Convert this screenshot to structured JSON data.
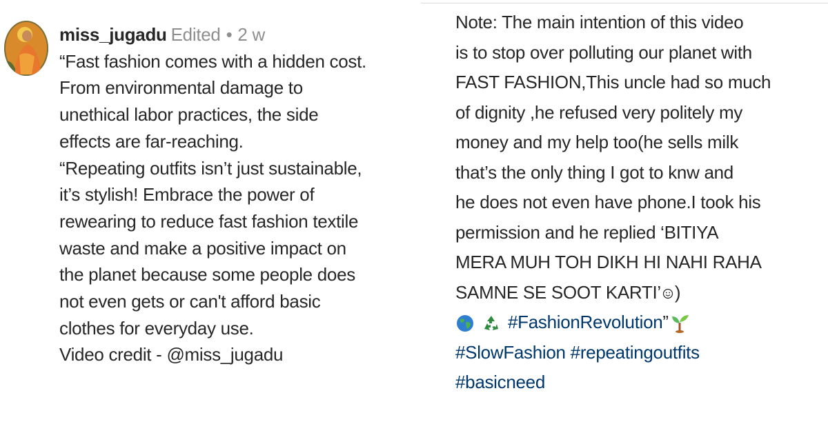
{
  "left_comment": {
    "username": "miss_jugadu",
    "edited_label": "Edited",
    "separator": "•",
    "time": "2 w",
    "lines": [
      "“Fast fashion comes with a hidden cost.",
      "From environmental damage to",
      "unethical labor practices, the side",
      "effects are far-reaching.",
      "“Repeating outfits isn’t just sustainable,",
      "it’s stylish! Embrace the power of",
      "rewearing to reduce fast fashion textile",
      "waste and make a positive impact on",
      "the planet because some people does",
      "not even gets or can't afford basic",
      "clothes for everyday use."
    ],
    "credit_prefix": "Video credit - ",
    "credit_handle": "@miss_jugadu"
  },
  "right_caption": {
    "lines": [
      "Note: The main intention of this video",
      "is to stop over polluting our planet with",
      "FAST FASHION,This uncle had so much",
      "of dignity ,he refused very politely my",
      "money and my help too(he sells milk",
      "that’s the only thing I got to knw and",
      "he does not even have phone.I took his",
      "permission and he replied ‘BITIYA",
      "MERA MUH TOH DIKH HI NAHI RAHA"
    ],
    "last_text_line": "SAMNE SE SOOT KARTI’",
    "last_text_suffix": ")",
    "emoji_hashtag": "#FashionRevolution",
    "emoji_hashtag_suffix": "”",
    "hashtag_line_1": [
      "#SlowFashion",
      "#repeatingoutfits"
    ],
    "hashtag_line_2": "#basicneed"
  },
  "icons": [
    "globe-icon",
    "recycle-icon",
    "seedling-icon",
    "smile-icon"
  ],
  "colors": {
    "text": "#262626",
    "meta": "#8e8e8e",
    "hashtag": "#00376b"
  }
}
